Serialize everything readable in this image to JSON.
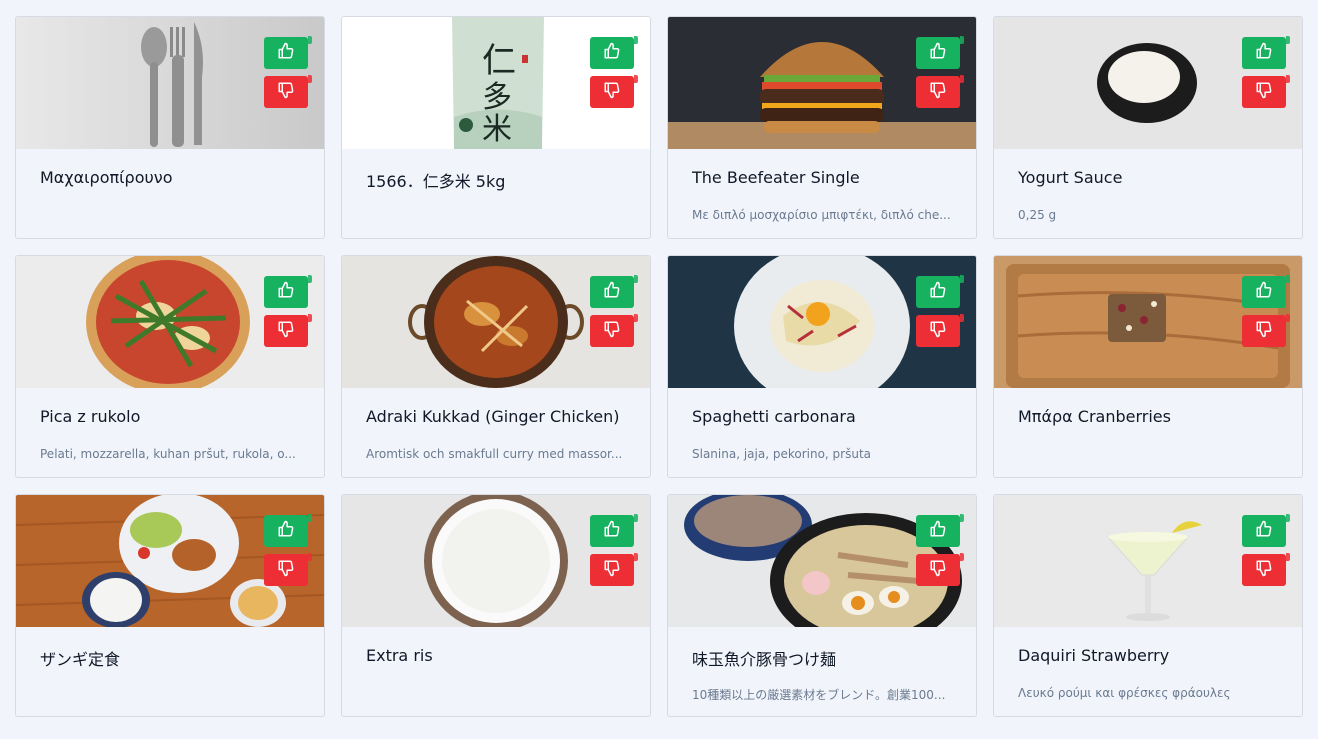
{
  "buttons": {
    "like_icon": "thumbs-up-icon",
    "dislike_icon": "thumbs-down-icon"
  },
  "colors": {
    "like": "#16b260",
    "dislike": "#ee2e35",
    "background": "#f1f5fb"
  },
  "products": [
    {
      "title": "Μαχαιροπίρουνο",
      "description": "",
      "image": "cutlery"
    },
    {
      "title": "1566．仁多米 5kg",
      "description": "",
      "image": "rice-bag"
    },
    {
      "title": "The Beefeater Single",
      "description": "Με διπλό μοσχαρίσιο μπιφτέκι, διπλό che...",
      "image": "burger"
    },
    {
      "title": "Yogurt Sauce",
      "description": "0,25 g",
      "image": "yogurt-sauce"
    },
    {
      "title": "Pica z rukolo",
      "description": "Pelati, mozzarella, kuhan pršut, rukola, o...",
      "image": "pizza"
    },
    {
      "title": "Adraki Kukkad (Ginger Chicken)",
      "description": "Aromtisk och smakfull curry med massor...",
      "image": "curry"
    },
    {
      "title": "Spaghetti carbonara",
      "description": "Slanina, jaja, pekorino, pršuta",
      "image": "carbonara"
    },
    {
      "title": "Μπάρα Cranberries",
      "description": "",
      "image": "cranberry-bar"
    },
    {
      "title": "ザンギ定食",
      "description": "",
      "image": "zangi-set"
    },
    {
      "title": "Extra ris",
      "description": "",
      "image": "rice-bowl"
    },
    {
      "title": "味玉魚介豚骨つけ麺",
      "description": "10種類以上の厳選素材をブレンド。創業100...",
      "image": "tsukemen"
    },
    {
      "title": "Daquiri Strawberry",
      "description": "Λευκό ρούμι και φρέσκες φράουλες",
      "image": "daiquiri"
    }
  ]
}
